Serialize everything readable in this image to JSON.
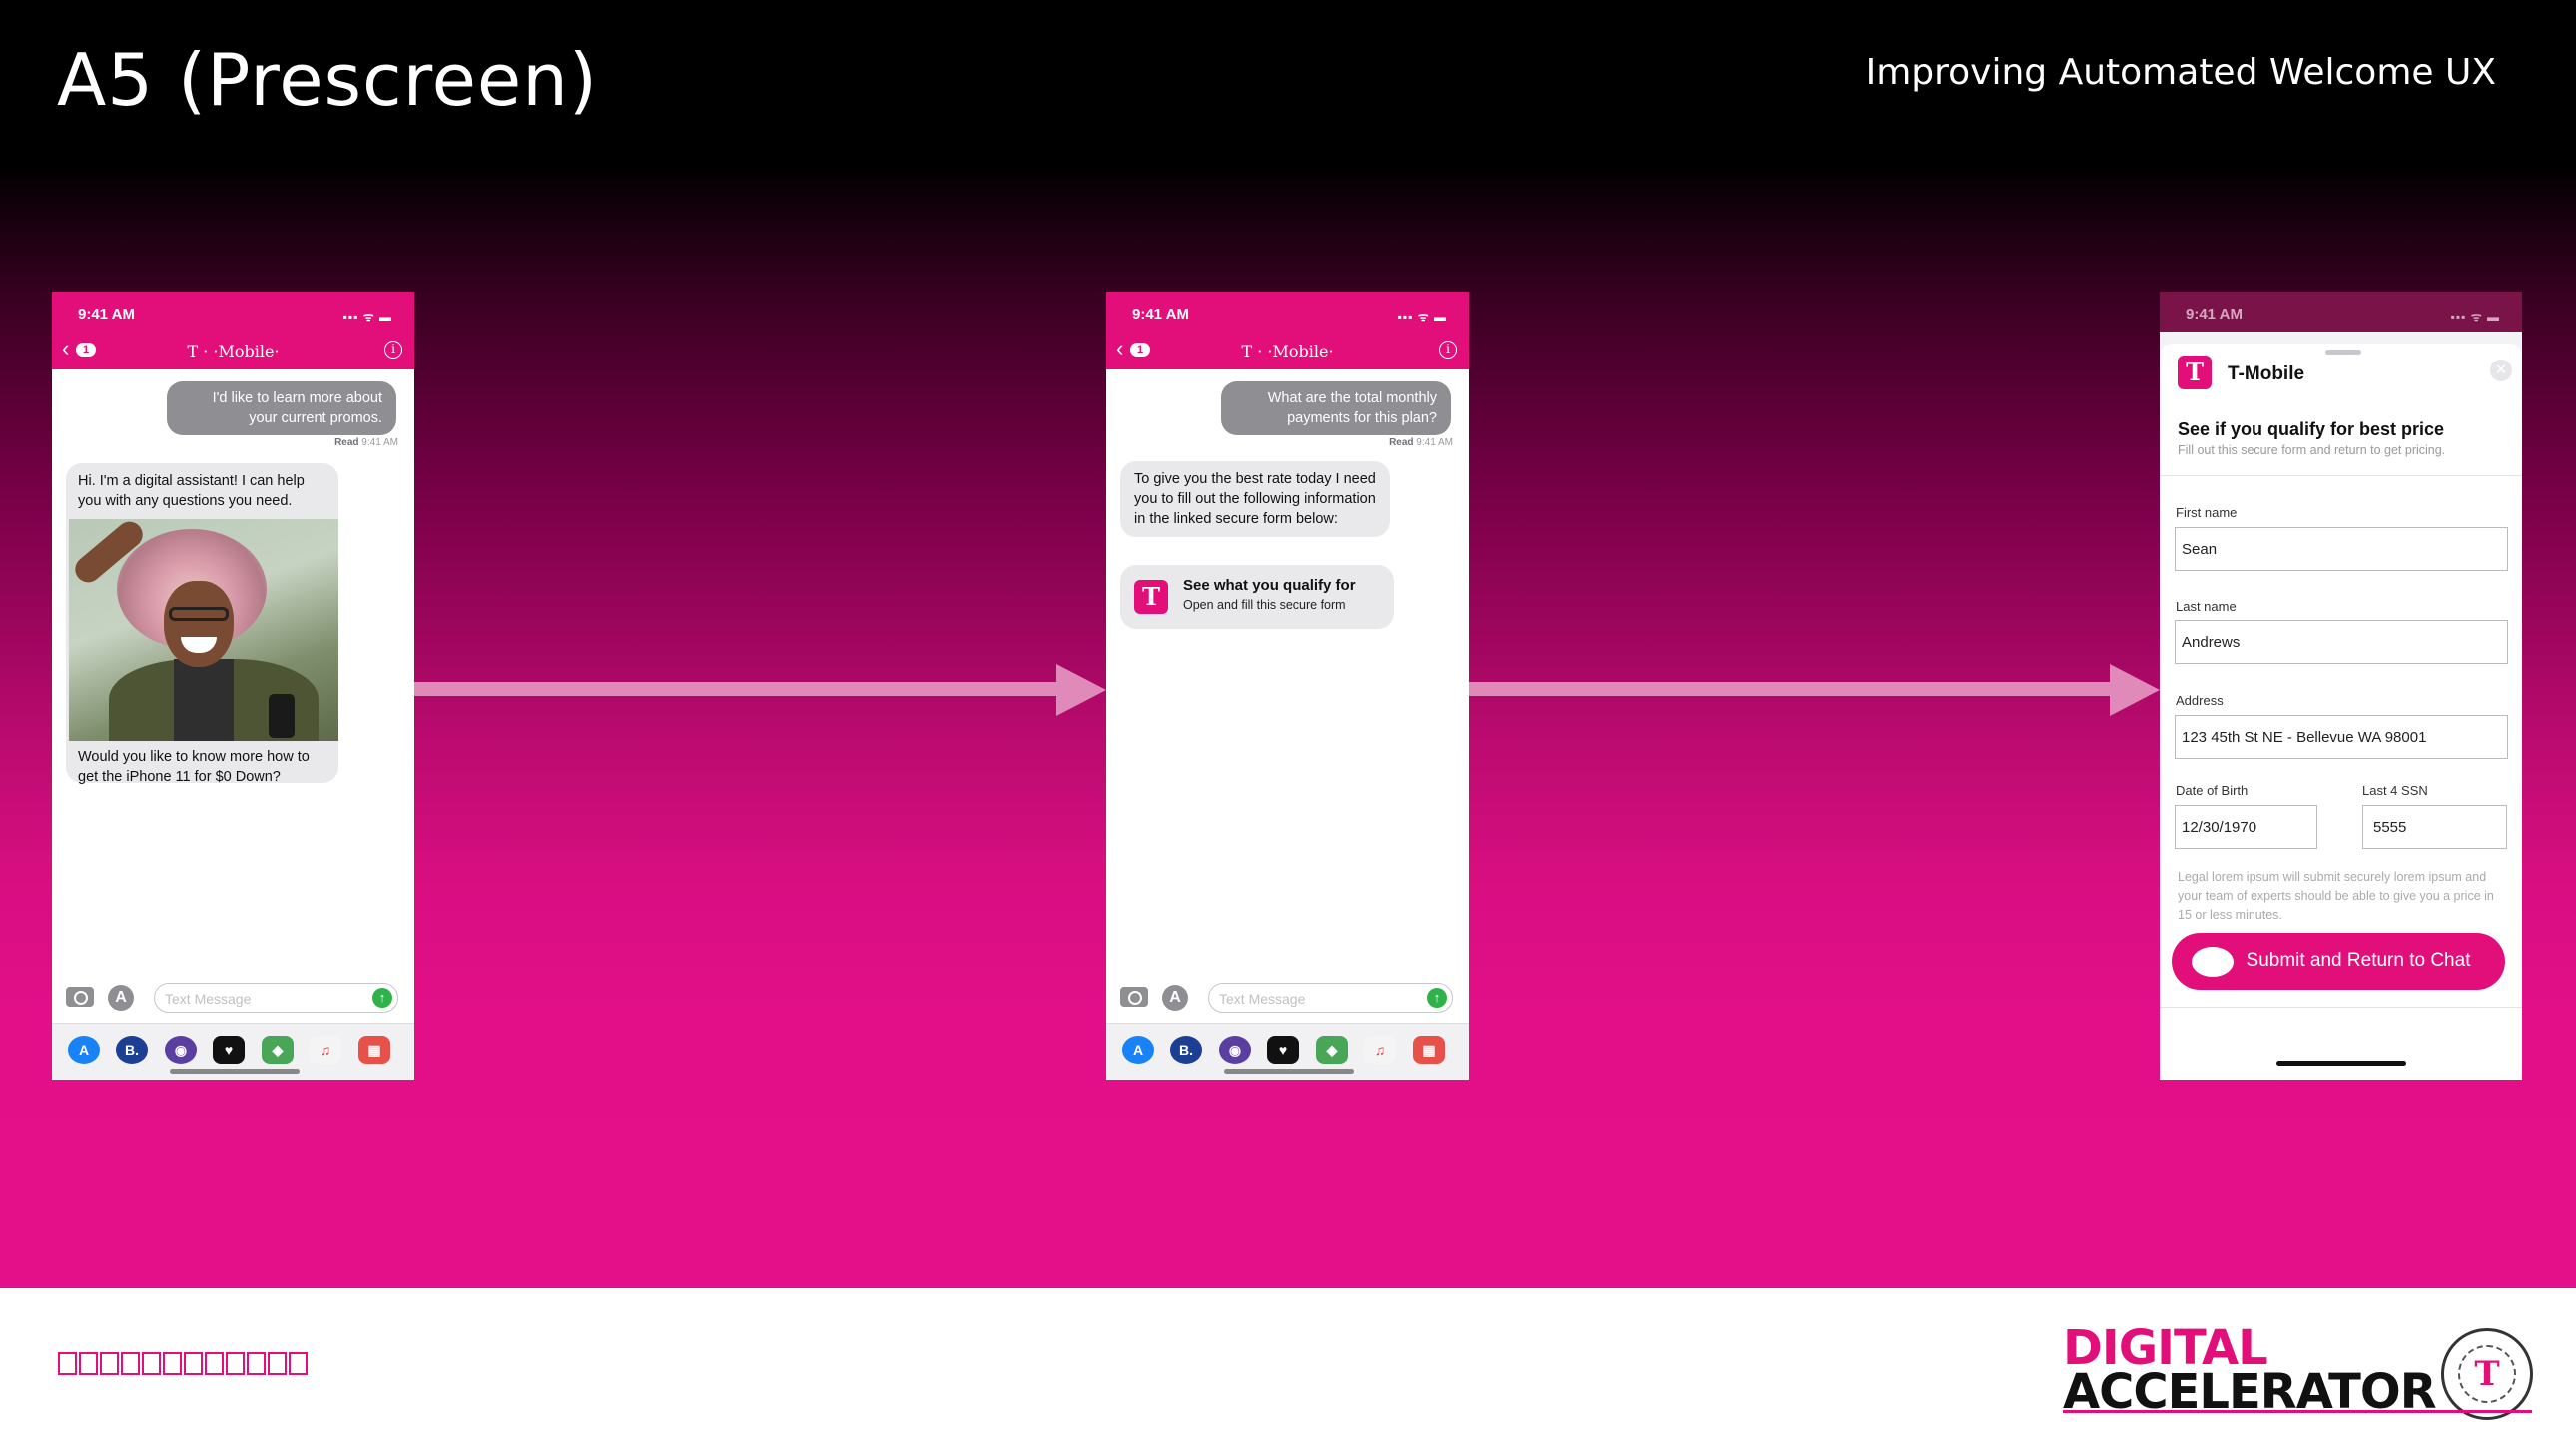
{
  "slide": {
    "title": "A5 (Prescreen)",
    "subtitle": "Improving Automated Welcome UX"
  },
  "phone_common": {
    "time": "9:41 AM",
    "signal": "▪▪▪ ᯤ ▬",
    "back_badge": "1",
    "brand": "T · ·Mobile·",
    "info": "i",
    "read_label": "Read",
    "read_time": "9:41 AM",
    "text_placeholder": "Text Message",
    "send_glyph": "↑"
  },
  "phone1": {
    "outgoing": "I'd like to learn more about your current promos.",
    "incoming_1": "Hi.  I'm a digital assistant!  I can help you with any questions you need.",
    "incoming_2": "Would you like to know more how to get the iPhone 11 for $0 Down?"
  },
  "phone2": {
    "outgoing": "What are the total monthly payments for this plan?",
    "incoming": "To give you the best rate today I need you to fill out the following information in the linked secure form below:",
    "card_title": "See what you qualify for",
    "card_sub": "Open and fill this secure form"
  },
  "phone3": {
    "brand": "T-Mobile",
    "logo_glyph": "T",
    "heading": "See if you qualify for best price",
    "subheading": "Fill out this secure form and return to get pricing.",
    "fields": {
      "first_name_label": "First name",
      "first_name_value": "Sean",
      "last_name_label": "Last name",
      "last_name_value": "Andrews",
      "address_label": "Address",
      "address_value": "123 45th St NE - Bellevue WA 98001",
      "dob_label": "Date of Birth",
      "dob_value": "12/30/1970",
      "ssn_label": "Last 4 SSN",
      "ssn_value": "5555"
    },
    "legal": "Legal lorem ipsum will submit securely lorem ipsum and your team of experts should be able to give you a price in 15 or less minutes.",
    "submit_label": "Submit and Return to Chat"
  },
  "dock_icons": [
    {
      "name": "app-store-icon",
      "glyph": "A",
      "color": "#1a82f7"
    },
    {
      "name": "b-app-icon",
      "glyph": "B.",
      "color": "#1c3f94"
    },
    {
      "name": "podcast-icon",
      "glyph": "◉",
      "color": "#5b3fa0"
    },
    {
      "name": "heart-app-icon",
      "glyph": "♥",
      "color": "#111111"
    },
    {
      "name": "maps-icon",
      "glyph": "◆",
      "color": "#4aa657"
    },
    {
      "name": "music-icon",
      "glyph": "♫",
      "color": "#f4f4f4"
    },
    {
      "name": "games-icon",
      "glyph": "▦",
      "color": "#e8504a"
    }
  ],
  "footer": {
    "logo_line1": "DIGITAL",
    "logo_line2": "ACCELERATOR",
    "logo_glyph": "T"
  },
  "colors": {
    "brand_magenta": "#e20f7b",
    "arrow": "#e08ab9"
  }
}
